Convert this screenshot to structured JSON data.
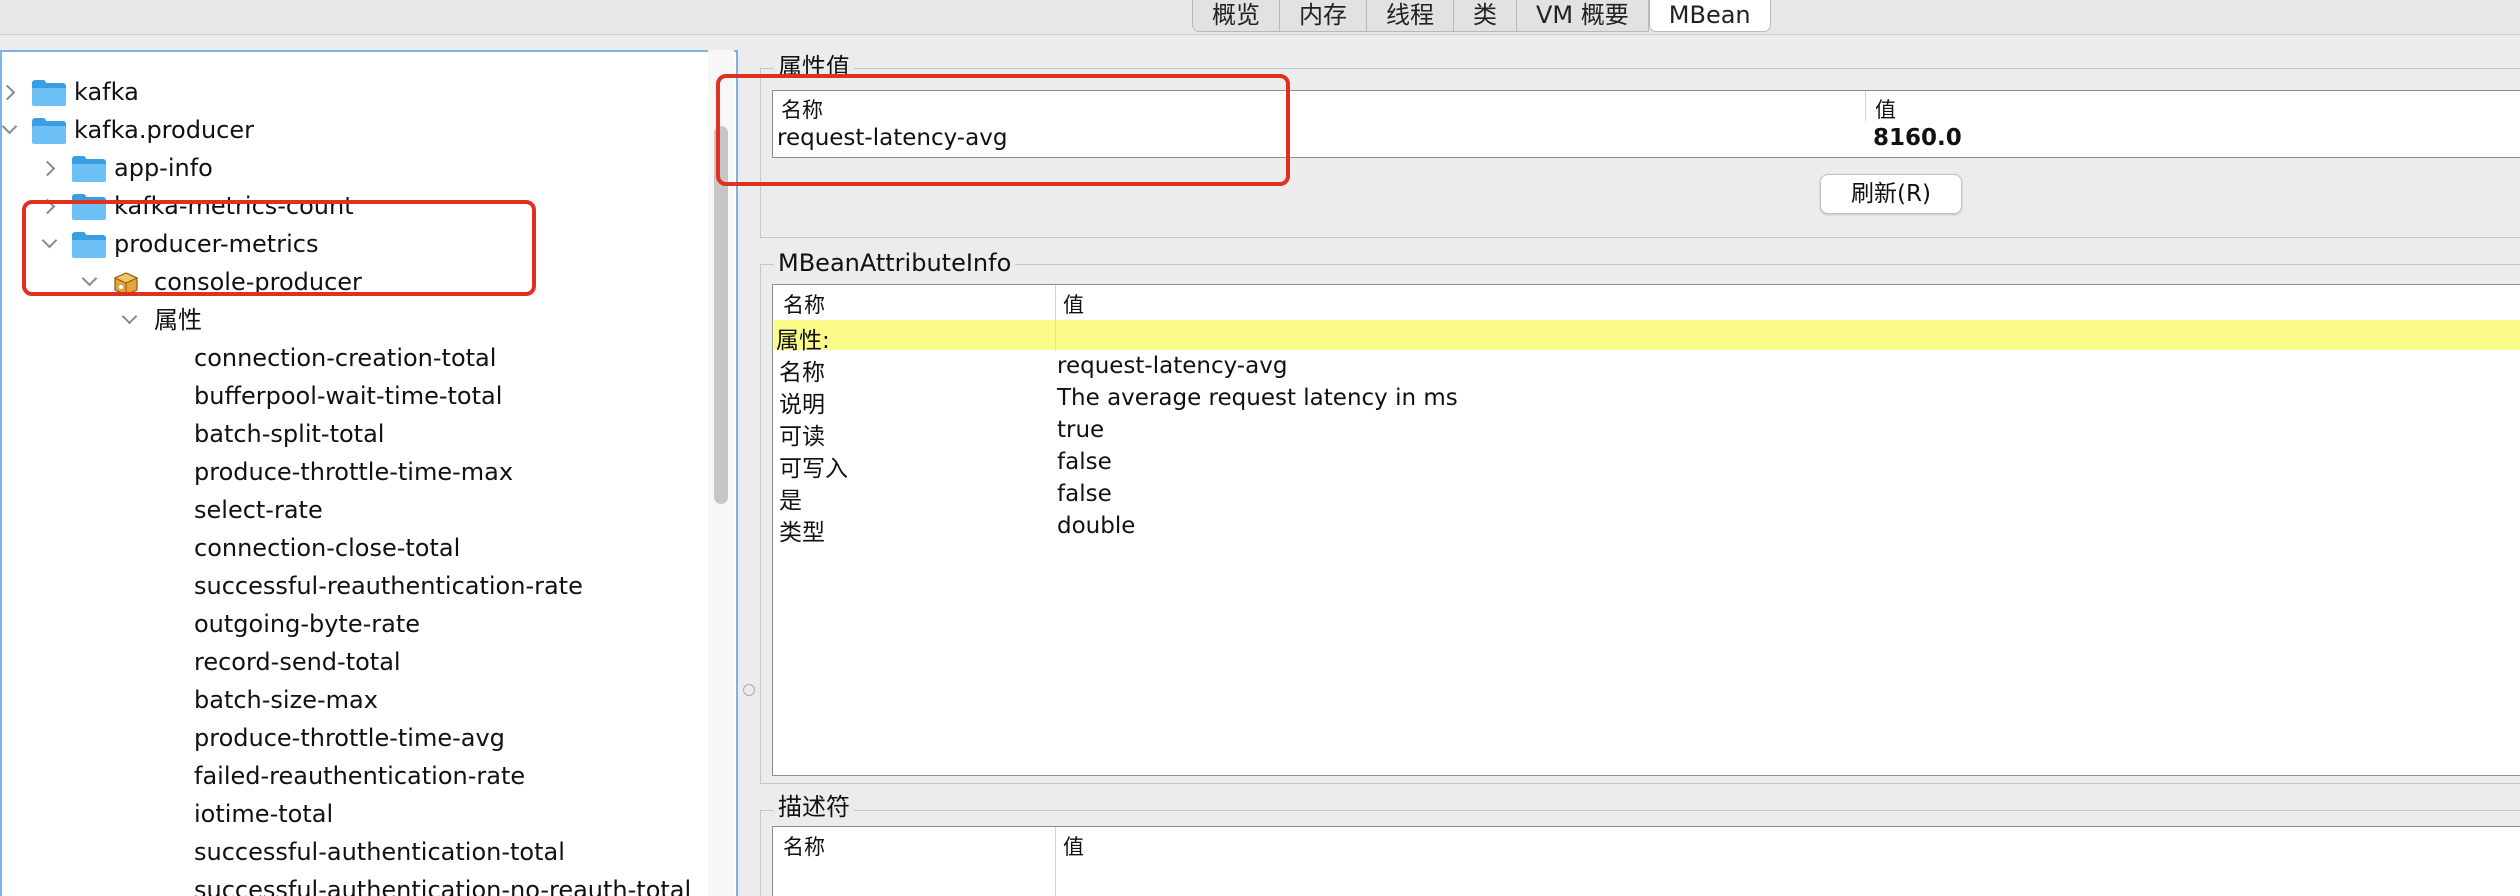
{
  "tabs": [
    "概览",
    "内存",
    "线程",
    "类",
    "VM 概要",
    "MBean"
  ],
  "active_tab": "MBean",
  "tree": {
    "nodes": [
      {
        "label": "kafka",
        "chevron": "right",
        "icon": "folder-icon"
      },
      {
        "label": "kafka.producer",
        "chevron": "down",
        "icon": "folder-icon"
      },
      {
        "label": "app-info",
        "chevron": "right",
        "icon": "folder-icon"
      },
      {
        "label": "kafka-metrics-count",
        "chevron": "right",
        "icon": "folder-icon"
      },
      {
        "label": "producer-metrics",
        "chevron": "down",
        "icon": "folder-icon"
      },
      {
        "label": "console-producer",
        "chevron": "down",
        "icon": "mbean-icon"
      },
      {
        "label": "属性",
        "chevron": "down",
        "icon": "none"
      }
    ],
    "attributes": [
      "connection-creation-total",
      "bufferpool-wait-time-total",
      "batch-split-total",
      "produce-throttle-time-max",
      "select-rate",
      "connection-close-total",
      "successful-reauthentication-rate",
      "outgoing-byte-rate",
      "record-send-total",
      "batch-size-max",
      "produce-throttle-time-avg",
      "failed-reauthentication-rate",
      "iotime-total",
      "successful-authentication-total",
      "successful-authentication-no-reauth-total"
    ]
  },
  "attribute_value": {
    "title": "属性值",
    "header_name": "名称",
    "header_value": "值",
    "name": "request-latency-avg",
    "value": "8160.0",
    "refresh_label": "刷新(R)"
  },
  "info": {
    "title": "MBeanAttributeInfo",
    "header_name": "名称",
    "header_value": "值",
    "section_label": "属性:",
    "rows": [
      {
        "name": "名称",
        "value": "request-latency-avg"
      },
      {
        "name": "说明",
        "value": "The average request latency in ms"
      },
      {
        "name": "可读",
        "value": "true"
      },
      {
        "name": "可写入",
        "value": "false"
      },
      {
        "name": "是",
        "value": "false"
      },
      {
        "name": "类型",
        "value": "double"
      }
    ]
  },
  "descriptor": {
    "title": "描述符",
    "header_name": "名称",
    "header_value": "值"
  },
  "colors": {
    "annotation_red": "#e0301e",
    "highlight_yellow": "#fbfb8c",
    "folder_blue": "#3a9ee4"
  }
}
